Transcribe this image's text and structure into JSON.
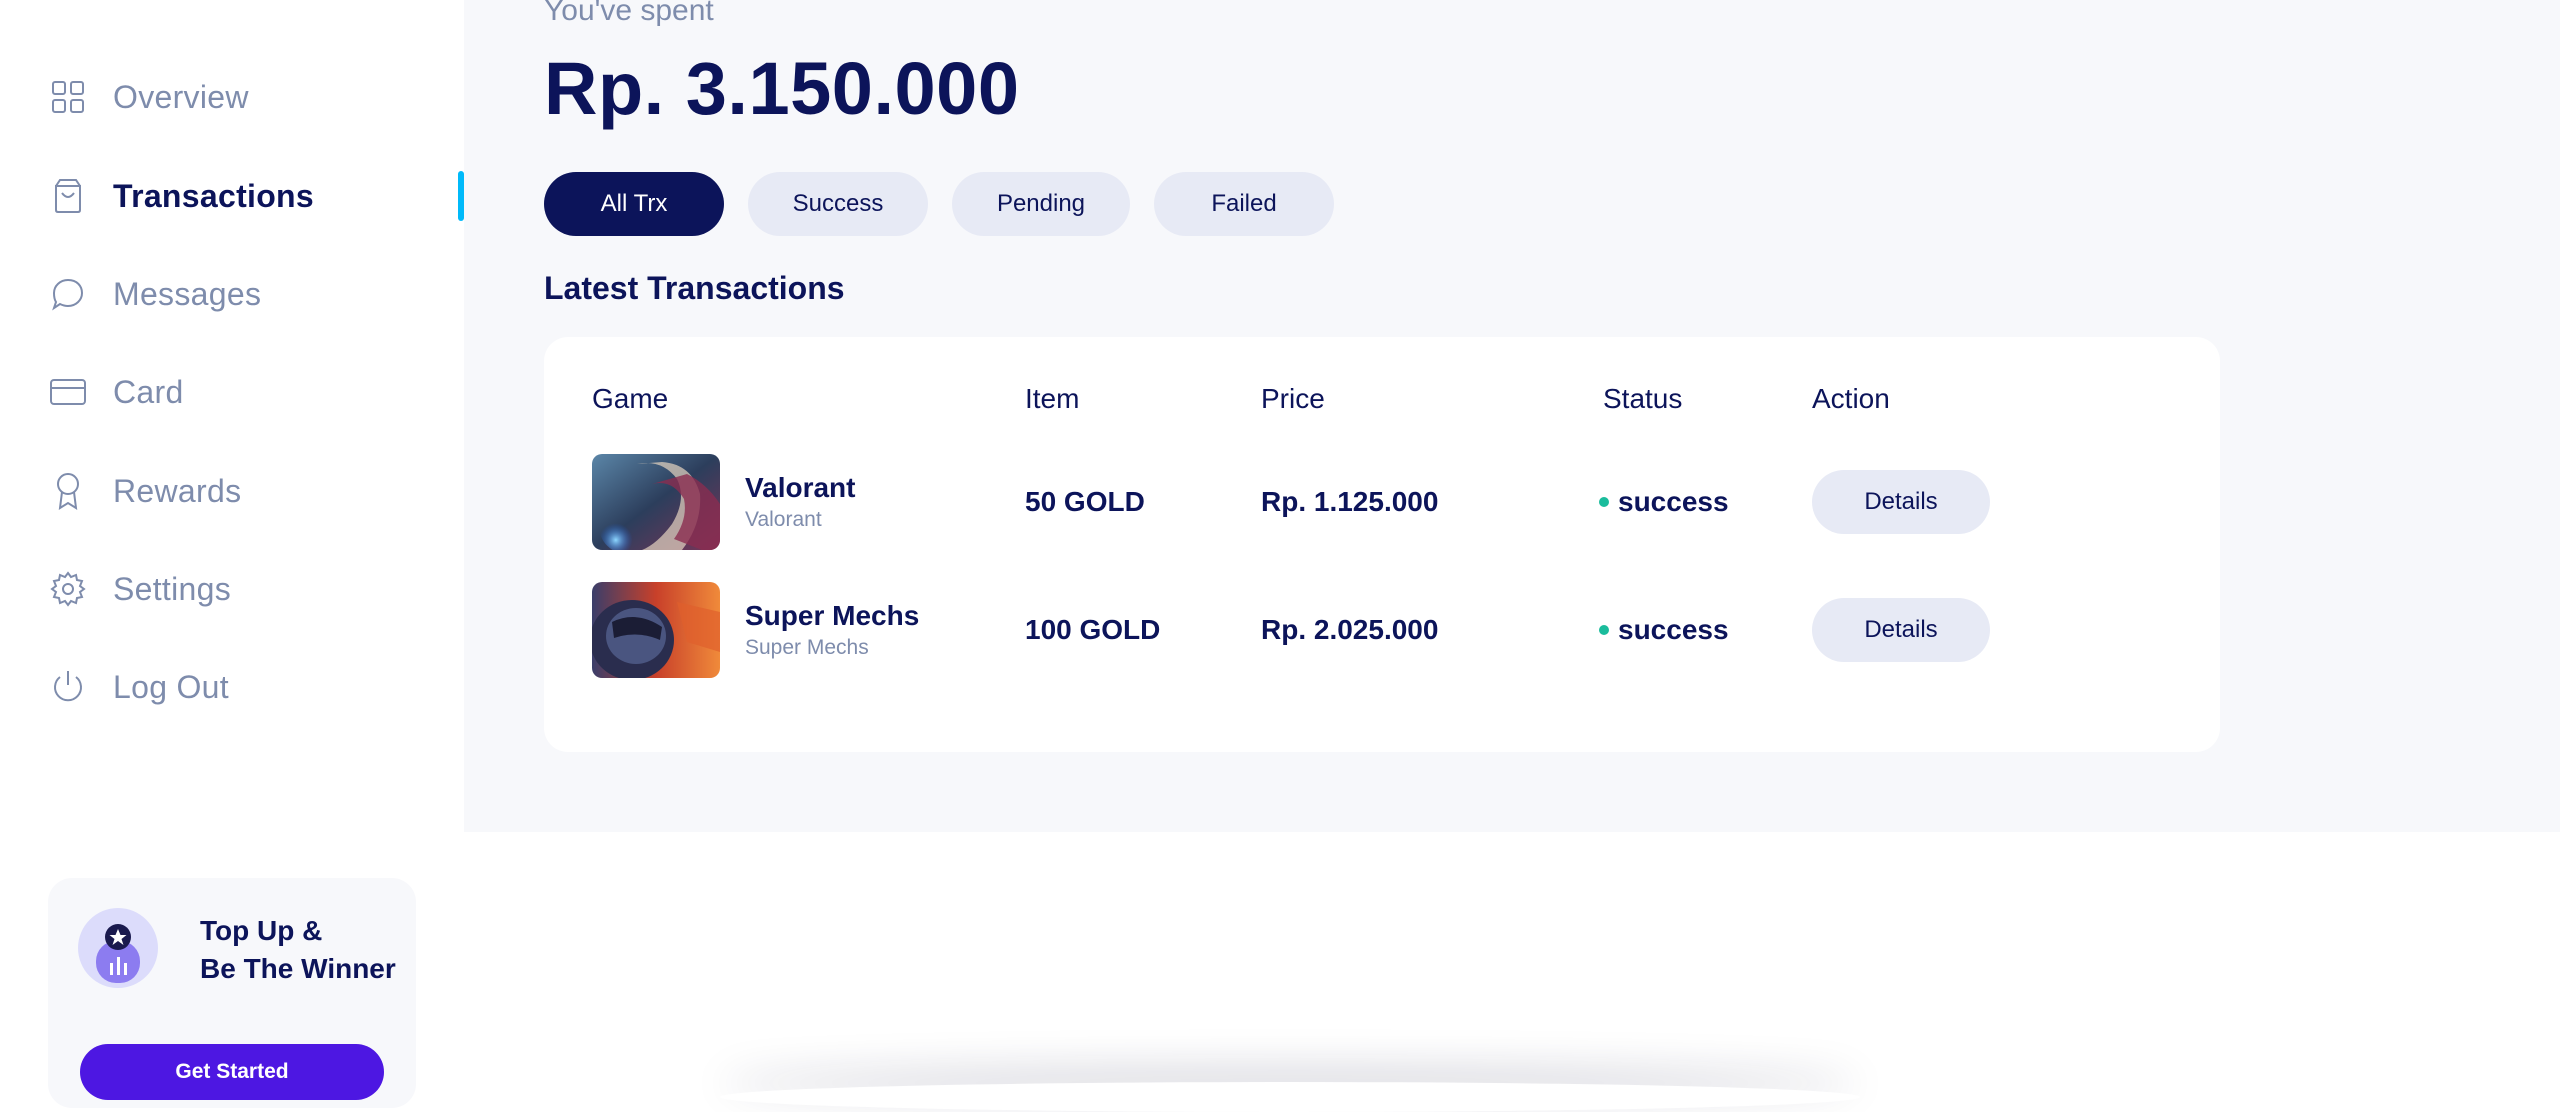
{
  "sidebar": {
    "items": [
      {
        "label": "Overview",
        "icon": "grid-icon"
      },
      {
        "label": "Transactions",
        "icon": "bag-icon",
        "active": true
      },
      {
        "label": "Messages",
        "icon": "chat-icon"
      },
      {
        "label": "Card",
        "icon": "card-icon"
      },
      {
        "label": "Rewards",
        "icon": "award-icon"
      },
      {
        "label": "Settings",
        "icon": "gear-icon"
      },
      {
        "label": "Log Out",
        "icon": "power-icon"
      }
    ],
    "promo": {
      "line1": "Top Up &",
      "line2": "Be The Winner",
      "button": "Get Started"
    }
  },
  "summary": {
    "label": "You've spent",
    "amount": "Rp. 3.150.000"
  },
  "filters": {
    "tabs": [
      "All Trx",
      "Success",
      "Pending",
      "Failed"
    ],
    "active": "All Trx"
  },
  "transactions": {
    "title": "Latest Transactions",
    "columns": [
      "Game",
      "Item",
      "Price",
      "Status",
      "Action"
    ],
    "rows": [
      {
        "game": "Valorant",
        "sub": "Valorant",
        "item": "50 GOLD",
        "price": "Rp. 1.125.000",
        "status": "success",
        "action": "Details"
      },
      {
        "game": "Super Mechs",
        "sub": "Super Mechs",
        "item": "100 GOLD",
        "price": "Rp. 2.025.000",
        "status": "success",
        "action": "Details"
      }
    ]
  },
  "colors": {
    "primary": "#0c145a",
    "accent": "#00bafa",
    "muted": "#7e8cac",
    "success": "#1abc9c",
    "cta": "#4d17e2"
  }
}
